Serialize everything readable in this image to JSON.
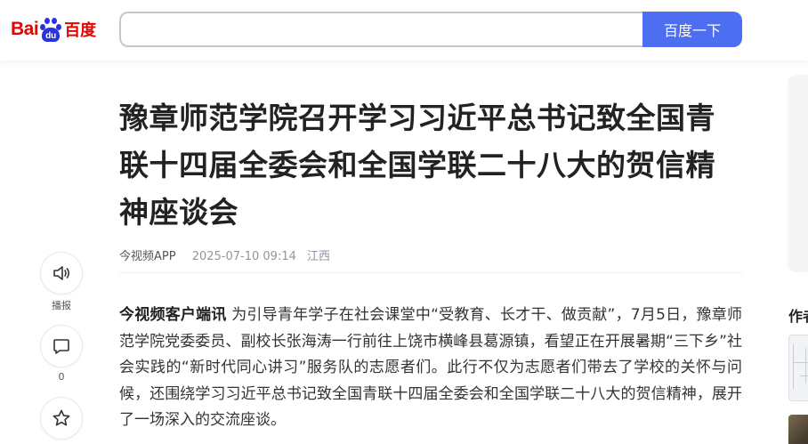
{
  "header": {
    "logo": {
      "left_text": "Bai",
      "paw_text": "du",
      "cn_text": "百度"
    },
    "search": {
      "value": "",
      "placeholder": ""
    },
    "search_button_label": "百度一下"
  },
  "toolbar": {
    "listen_label": "播报",
    "comment_count": "0",
    "icons": [
      "speaker-icon",
      "comment-icon",
      "star-icon"
    ]
  },
  "article": {
    "title": "豫章师范学院召开学习习近平总书记致全国青联十四届全委会和全国学联二十八大的贺信精神座谈会",
    "meta": {
      "source": "今视频APP",
      "time": "2025-07-10 09:14",
      "location": "江西"
    },
    "lead": "今视频客户端讯",
    "body": " 为引导青年学子在社会课堂中“受教育、长才干、做贡献”，7月5日，豫章师范学院党委委员、副校长张海涛一行前往上饶市横峰县葛源镇，看望正在开展暑期“三下乡”社会实践的“新时代同心讲习”服务队的志愿者们。此行不仅为志愿者们带去了学校的关怀与问候，还围绕学习习近平总书记致全国青联十四届全委会和全国学联二十八大的贺信精神，展开了一场深入的交流座谈。"
  },
  "sidebar": {
    "heading_partial": "作者"
  },
  "colors": {
    "brand_red": "#e10602",
    "brand_blue": "#2932e1",
    "button_blue": "#4e6ef2",
    "meta_gray": "#9195a3"
  }
}
